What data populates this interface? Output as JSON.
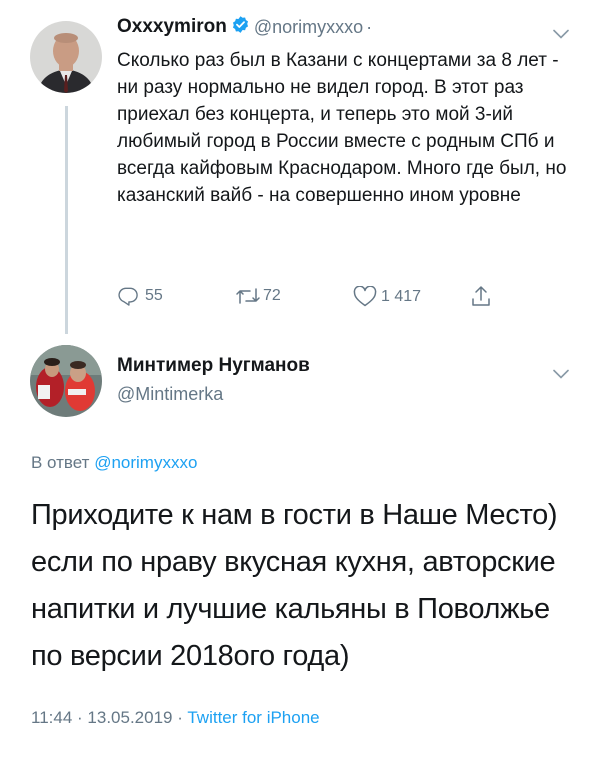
{
  "tweet1": {
    "display_name": "Oxxxymiron",
    "handle": "@norimyxxxo",
    "separator": "·",
    "text": "Сколько раз был в Казани с концертами за 8 лет - ни разу нормально не видел город. В этот раз приехал без концерта, и теперь это мой 3-ий любимый город в России вместе с родным СПб и всегда кайфовым Краснодаром. Много где был, но казанский вайб - на совершенно ином уровне",
    "replies": "55",
    "retweets": "72",
    "likes": "1 417",
    "icons": {
      "reply": "reply-icon",
      "retweet": "retweet-icon",
      "like": "heart-icon",
      "share": "share-icon",
      "menu": "chevron-down-icon",
      "verified": "verified-badge-icon"
    }
  },
  "tweet2": {
    "display_name": "Минтимер Нугманов",
    "handle": "@Mintimerka",
    "reply_prefix": "В ответ",
    "reply_to_handle": "@norimyxxxo",
    "text": "Приходите к нам в гости в Наше Место) если по нраву вкусная кухня, авторские напитки и лучшие кальяны в Поволжье по версии 2018ого года)",
    "time": "11:44",
    "date": "13.05.2019",
    "dot": "·",
    "source": "Twitter for iPhone"
  },
  "colors": {
    "text": "#14171a",
    "secondary": "#657786",
    "link": "#1da1f2",
    "thread_line": "#ccd6dd"
  }
}
